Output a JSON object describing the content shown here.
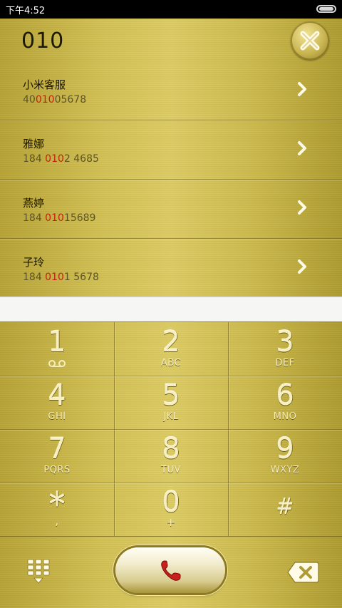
{
  "status_bar": {
    "time": "下午4:52"
  },
  "search": {
    "query": "010"
  },
  "contacts": [
    {
      "name": "小米客服",
      "num_pre": "40",
      "num_hl": "010",
      "num_post": "05678"
    },
    {
      "name": "雅娜",
      "num_pre": "184 ",
      "num_hl": "010",
      "num_post": "2 4685"
    },
    {
      "name": "燕婷",
      "num_pre": "184 ",
      "num_hl": "010",
      "num_post": "15689"
    },
    {
      "name": "子玲",
      "num_pre": "184 ",
      "num_hl": "010",
      "num_post": "1 5678"
    }
  ],
  "keypad": [
    {
      "digit": "1",
      "letters": ""
    },
    {
      "digit": "2",
      "letters": "ABC"
    },
    {
      "digit": "3",
      "letters": "DEF"
    },
    {
      "digit": "4",
      "letters": "GHI"
    },
    {
      "digit": "5",
      "letters": "JKL"
    },
    {
      "digit": "6",
      "letters": "MNO"
    },
    {
      "digit": "7",
      "letters": "PQRS"
    },
    {
      "digit": "8",
      "letters": "TUV"
    },
    {
      "digit": "9",
      "letters": "WXYZ"
    },
    {
      "digit": "*",
      "letters": ","
    },
    {
      "digit": "0",
      "letters": "+"
    },
    {
      "digit": "#",
      "letters": ""
    }
  ],
  "icons": {
    "close": "close-icon",
    "chevron": "chevron-right-icon",
    "voicemail": "voicemail-icon",
    "dialpad": "dialpad-icon",
    "call": "phone-icon",
    "backspace": "backspace-icon"
  },
  "colors": {
    "gold": "#d2c052",
    "highlight": "#c0230c",
    "call_handset": "#c8201a"
  }
}
